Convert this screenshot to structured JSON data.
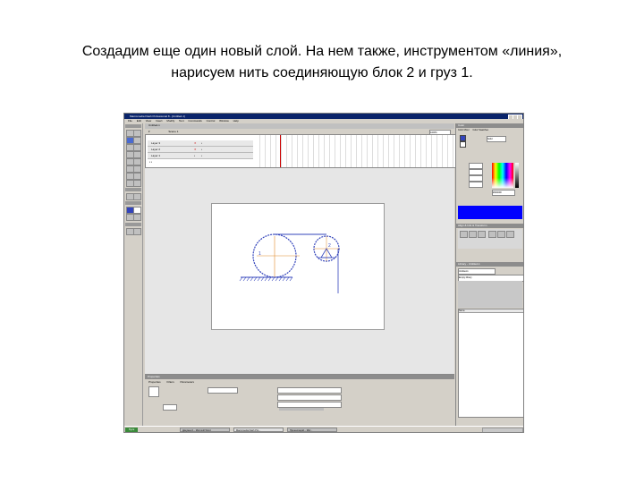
{
  "caption": {
    "line1": "Создадим еще один новый слой. На нем также, инструментом «линия»,",
    "line2": "нарисуем нить соединяющую блок 2 и груз 1."
  },
  "window": {
    "title": "Macromedia Flash Professional 8 - [Untitled-1]"
  },
  "menu": [
    "File",
    "Edit",
    "View",
    "Insert",
    "Modify",
    "Text",
    "Commands",
    "Control",
    "Window",
    "Help"
  ],
  "timeline": {
    "tab": "Untitled-1",
    "scene": "Scene 1",
    "zoom": "100%",
    "layers": [
      {
        "name": "Layer 3"
      },
      {
        "name": "Layer 2"
      },
      {
        "name": "Layer 1"
      }
    ]
  },
  "stage": {
    "drawing": {
      "block_label": "1",
      "weight_label": "2"
    }
  },
  "properties": {
    "title": "Properties",
    "tabs": [
      "Properties",
      "Filters",
      "Parameters"
    ]
  },
  "panels": {
    "color_title": "Color",
    "color_mixer_tab": "Color Mixer",
    "swatches_tab": "Color Swatches",
    "type_value": "Solid",
    "hex_value": "#0000FF",
    "align_title": "Align & Info & Transform",
    "library_title": "Library - Untitled-1",
    "library_item": "Untitled-1",
    "library_empty": "Empty library",
    "name_col": "Name"
  },
  "taskbar": {
    "start": "Пуск",
    "items": [
      "Документ1 - Microsoft Word",
      "Macromedia Flash Pro...",
      "Презентация1 - Micr..."
    ]
  },
  "colors": {
    "drawing_stroke": "#3344bb",
    "accent_blue": "#0000ff",
    "title_bar": "#0a246a"
  }
}
